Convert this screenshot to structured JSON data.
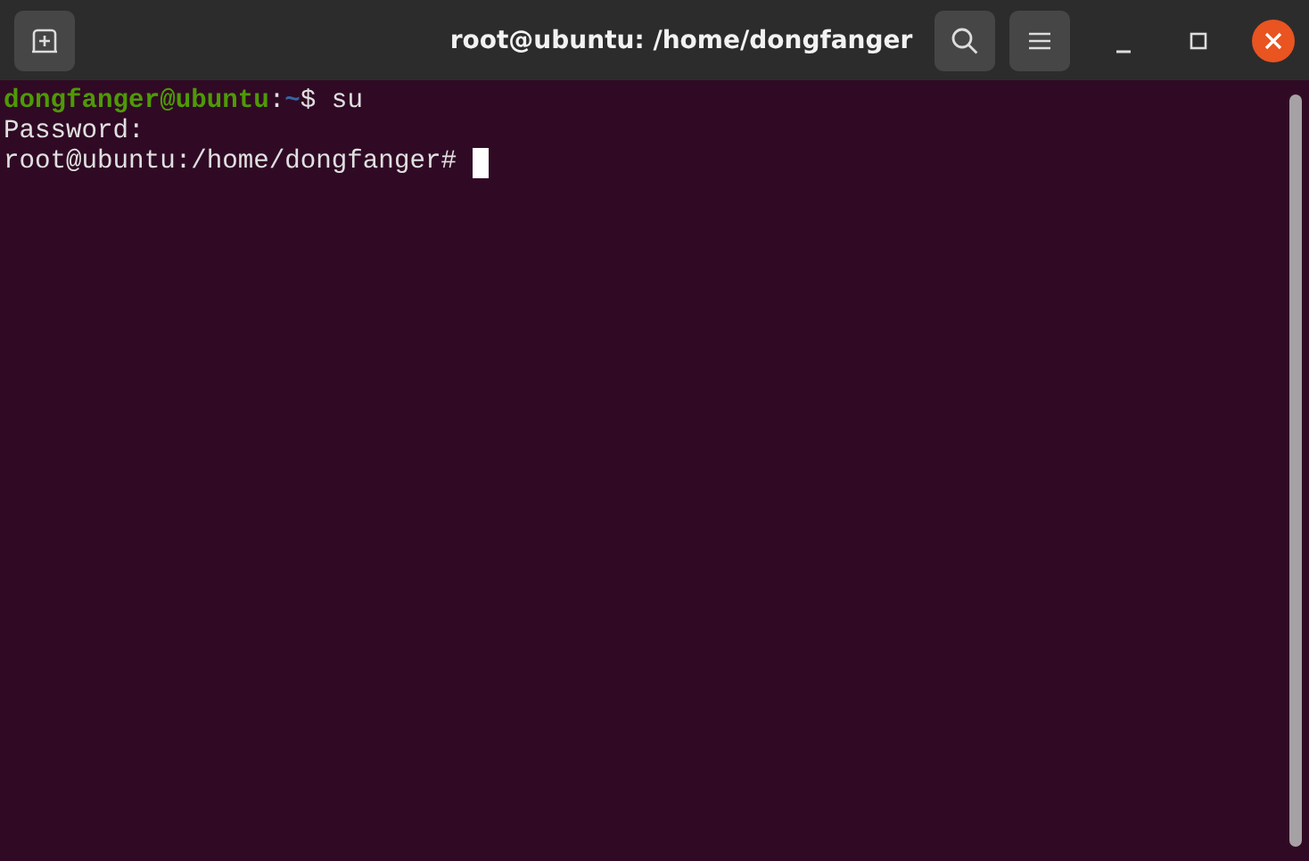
{
  "window": {
    "title": "root@ubuntu: /home/dongfanger"
  },
  "terminal": {
    "lines": [
      {
        "cursor": false,
        "segments": [
          {
            "kind": "user",
            "text": "dongfanger@ubuntu"
          },
          {
            "kind": "plain",
            "text": ":"
          },
          {
            "kind": "path",
            "text": "~"
          },
          {
            "kind": "plain",
            "text": "$ su"
          }
        ]
      },
      {
        "cursor": false,
        "segments": [
          {
            "kind": "plain",
            "text": "Password:"
          }
        ]
      },
      {
        "cursor": true,
        "segments": [
          {
            "kind": "plain",
            "text": "root@ubuntu:/home/dongfanger# "
          }
        ]
      }
    ]
  }
}
